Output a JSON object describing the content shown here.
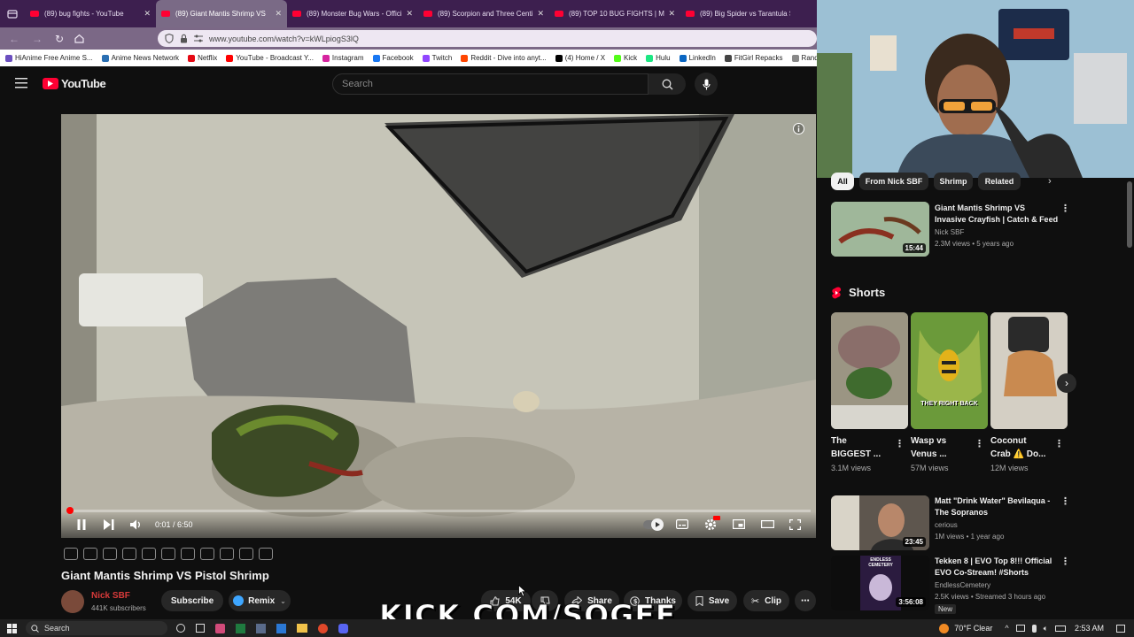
{
  "browser": {
    "tabs": [
      {
        "title": "(89) bug fights - YouTube",
        "active": false
      },
      {
        "title": "(89) Giant Mantis Shrimp VS",
        "active": true
      },
      {
        "title": "(89) Monster Bug Wars - Officia",
        "active": false
      },
      {
        "title": "(89) Scorpion and Three Centip",
        "active": false
      },
      {
        "title": "(89) TOP 10 BUG FIGHTS | MON",
        "active": false
      },
      {
        "title": "(89) Big Spider vs Tarantula Spi",
        "active": false
      }
    ],
    "url": "www.youtube.com/watch?v=kWLpiogS3lQ",
    "bookmarks": [
      {
        "label": "HiAnime Free Anime S...",
        "color": "#6b4fbf"
      },
      {
        "label": "Anime News Network",
        "color": "#2a6fb3"
      },
      {
        "label": "Netflix",
        "color": "#e50914"
      },
      {
        "label": "YouTube - Broadcast Y...",
        "color": "#ff0000"
      },
      {
        "label": "Instagram",
        "color": "#d6249f"
      },
      {
        "label": "Facebook",
        "color": "#1877f2"
      },
      {
        "label": "Twitch",
        "color": "#9146ff"
      },
      {
        "label": "Reddit - Dive into anyt...",
        "color": "#ff4500"
      },
      {
        "label": "(4) Home / X",
        "color": "#000000"
      },
      {
        "label": "Kick",
        "color": "#53fc18"
      },
      {
        "label": "Hulu",
        "color": "#1ce783"
      },
      {
        "label": "LinkedIn",
        "color": "#0a66c2"
      },
      {
        "label": "FitGirl Repacks",
        "color": "#444444"
      },
      {
        "label": "Rand",
        "color": "#888888"
      }
    ]
  },
  "youtube": {
    "logo_text": "YouTube",
    "search_placeholder": "Search",
    "player": {
      "time": "0:01 / 6:50",
      "progress": 0.003
    },
    "video_title": "Giant Mantis Shrimp VS Pistol Shrimp",
    "channel": {
      "name": "Nick SBF",
      "subscribers": "441K subscribers"
    },
    "actions": {
      "subscribe": "Subscribe",
      "remix": "Remix",
      "likes": "54K",
      "share": "Share",
      "thanks": "Thanks",
      "save": "Save",
      "clip": "Clip"
    },
    "filter_chips": [
      "All",
      "From Nick SBF",
      "Shrimp",
      "Related"
    ],
    "recommended_top": {
      "title_line1": "Giant Mantis Shrimp VS",
      "title_line2": "Invasive Crayfish | Catch & Feed",
      "channel": "Nick SBF",
      "meta": "2.3M views • 5 years ago",
      "duration": "15:44"
    },
    "shorts_heading": "Shorts",
    "shorts": [
      {
        "title_line1": "The",
        "title_line2": "BIGGEST ...",
        "views": "3.1M views",
        "overlay": ""
      },
      {
        "title_line1": "Wasp vs",
        "title_line2": "Venus ...",
        "views": "57M views",
        "overlay": "THEY RIGHT BACK"
      },
      {
        "title_line1": "Coconut",
        "title_line2": "Crab ⚠️ Do...",
        "views": "12M views",
        "overlay": ""
      }
    ],
    "recommended": [
      {
        "title_line1": "Matt \"Drink Water\" Bevilaqua -",
        "title_line2": "The Sopranos",
        "channel": "cerious",
        "meta": "1M views • 1 year ago",
        "duration": "23:45",
        "badge": ""
      },
      {
        "title_line1": "Tekken 8 | EVO Top 8!!! Official",
        "title_line2": "EVO Co-Stream! #Shorts",
        "channel": "EndlessCemetery",
        "meta": "2.5K views • Streamed 3 hours ago",
        "duration": "3:56:08",
        "badge": "New",
        "thumb_text": "ENDLESS CEMETERY"
      }
    ]
  },
  "overlay": {
    "kick_text": "KICK.COM/SOGEE"
  },
  "taskbar": {
    "search": "Search",
    "weather": "70°F  Clear",
    "time": "2:53 AM"
  }
}
